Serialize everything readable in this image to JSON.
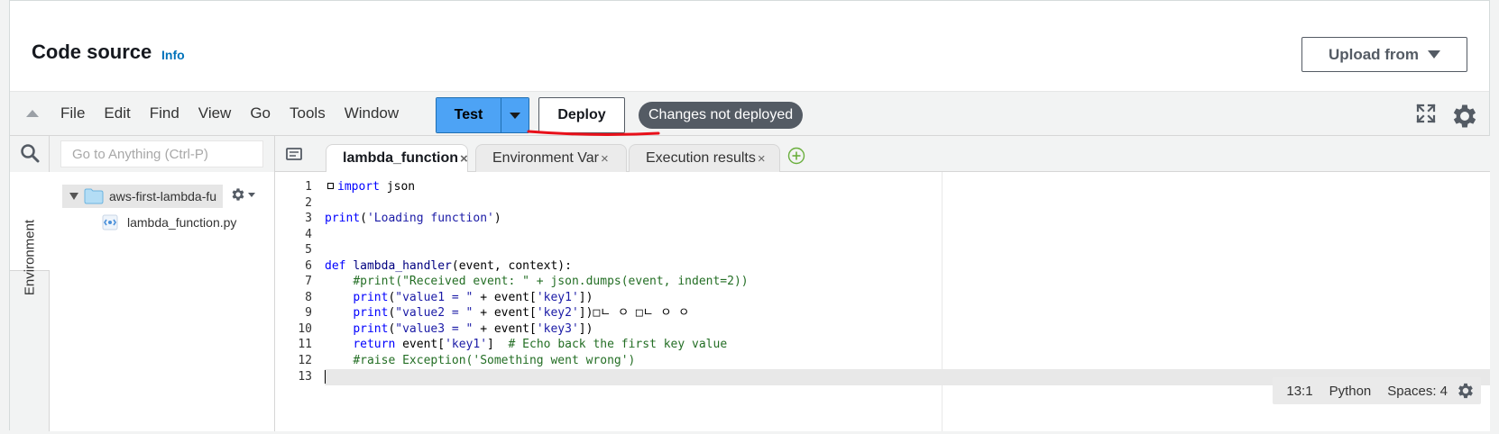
{
  "header": {
    "title": "Code source",
    "info": "Info",
    "upload_label": "Upload from"
  },
  "toolbar": {
    "menu": [
      "File",
      "Edit",
      "Find",
      "View",
      "Go",
      "Tools",
      "Window"
    ],
    "test_label": "Test",
    "deploy_label": "Deploy",
    "status_badge": "Changes not deployed"
  },
  "sidebar": {
    "environment_label": "Environment",
    "search_placeholder": "Go to Anything (Ctrl-P)",
    "folder_name": "aws-first-lambda-fur",
    "file_name": "lambda_function.py"
  },
  "tabs": [
    {
      "label": "lambda_function",
      "active": true
    },
    {
      "label": "Environment Var",
      "active": false
    },
    {
      "label": "Execution results",
      "active": false
    }
  ],
  "code": {
    "language": "Python",
    "lines": [
      "import json",
      "",
      "print('Loading function')",
      "",
      "",
      "def lambda_handler(event, context):",
      "    #print(\"Received event: \" + json.dumps(event, indent=2))",
      "    print(\"value1 = \" + event['key1'])",
      "    print(\"value2 = \" + event['key2'])□ㄴ ㅇ □ㄴ ㅇ ㅇ",
      "    print(\"value3 = \" + event['key3'])",
      "    return event['key1']  # Echo back the first key value",
      "    #raise Exception('Something went wrong')",
      ""
    ]
  },
  "status": {
    "position": "13:1",
    "language": "Python",
    "spaces": "Spaces: 4"
  },
  "colors": {
    "test_button": "#4da3f5",
    "badge": "#545b64",
    "annotation_underline": "#e8101a",
    "link": "#0073bb"
  }
}
